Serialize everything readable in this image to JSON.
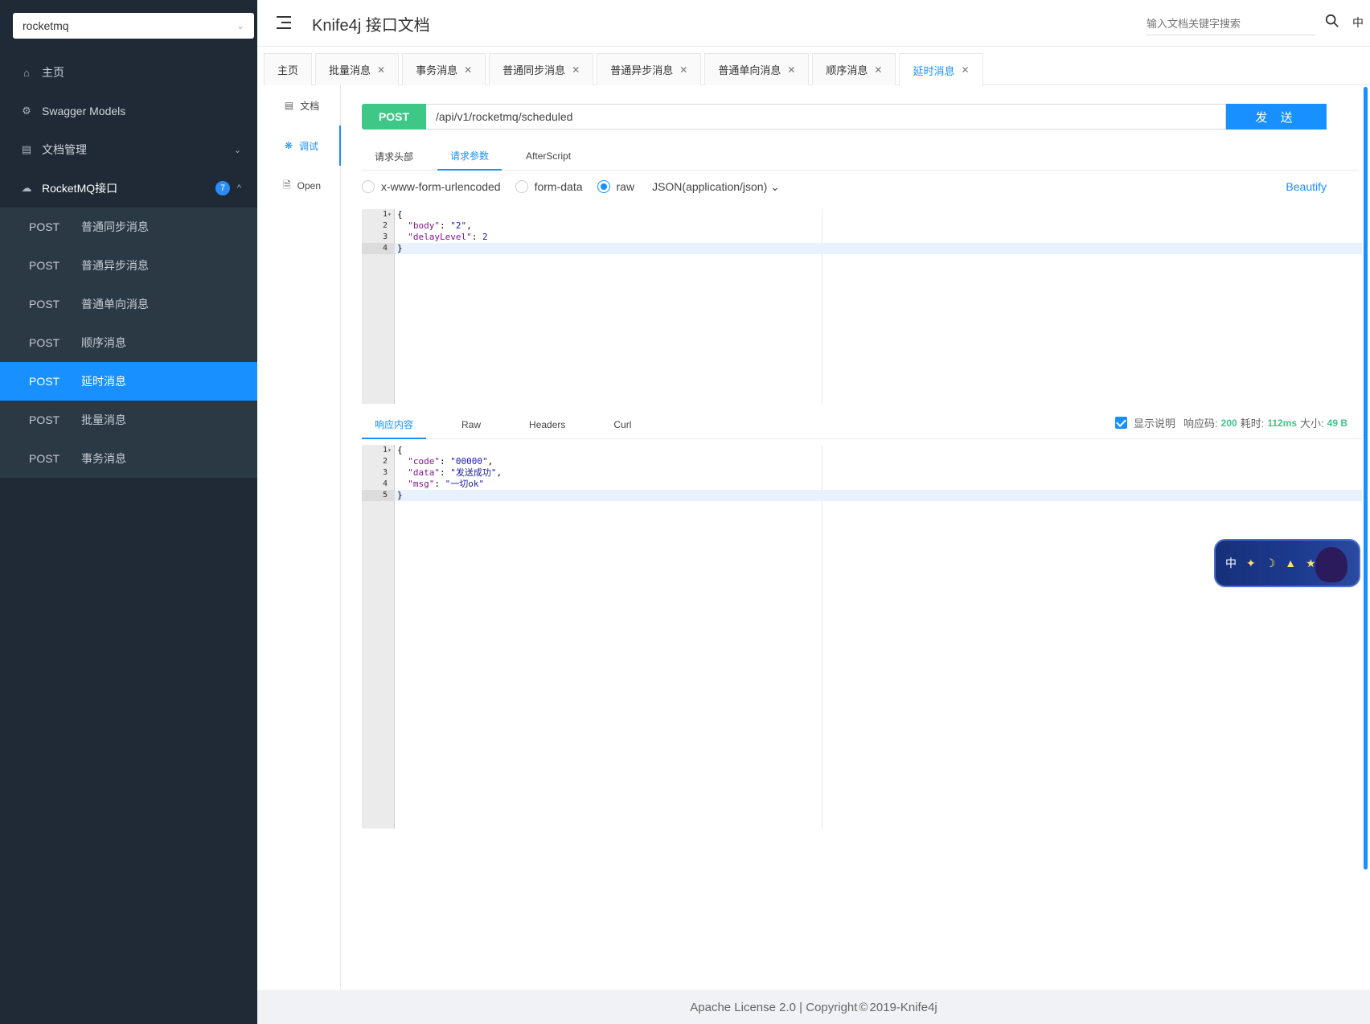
{
  "sidebar": {
    "group_select": "rocketmq",
    "items": [
      {
        "label": "主页",
        "icon": "home-icon"
      },
      {
        "label": "Swagger Models",
        "icon": "gear-icon"
      },
      {
        "label": "文档管理",
        "icon": "document-manage-icon"
      },
      {
        "label": "RocketMQ接口",
        "icon": "cloud-icon",
        "badge": "7"
      }
    ],
    "api_items": [
      {
        "method": "POST",
        "label": "普通同步消息"
      },
      {
        "method": "POST",
        "label": "普通异步消息"
      },
      {
        "method": "POST",
        "label": "普通单向消息"
      },
      {
        "method": "POST",
        "label": "顺序消息"
      },
      {
        "method": "POST",
        "label": "延时消息",
        "active": true
      },
      {
        "method": "POST",
        "label": "批量消息"
      },
      {
        "method": "POST",
        "label": "事务消息"
      }
    ]
  },
  "header": {
    "title": "Knife4j 接口文档",
    "search_placeholder": "输入文档关键字搜索",
    "lang": "中"
  },
  "tabs": [
    {
      "label": "主页",
      "closable": false
    },
    {
      "label": "批量消息",
      "closable": true
    },
    {
      "label": "事务消息",
      "closable": true
    },
    {
      "label": "普通同步消息",
      "closable": true
    },
    {
      "label": "普通异步消息",
      "closable": true
    },
    {
      "label": "普通单向消息",
      "closable": true
    },
    {
      "label": "顺序消息",
      "closable": true
    },
    {
      "label": "延时消息",
      "closable": true,
      "active": true
    }
  ],
  "doc_nav": [
    {
      "label": "文档",
      "icon": "document-icon"
    },
    {
      "label": "调试",
      "icon": "bug-icon",
      "active": true
    },
    {
      "label": "Open",
      "icon": "file-icon"
    }
  ],
  "request": {
    "method": "POST",
    "url": "/api/v1/rocketmq/scheduled",
    "send_label": "发 送",
    "tabs": [
      "请求头部",
      "请求参数",
      "AfterScript"
    ],
    "active_tab": "请求参数",
    "body_types": [
      "x-www-form-urlencoded",
      "form-data",
      "raw"
    ],
    "selected_body_type": "raw",
    "content_type": "JSON(application/json)",
    "beautify_label": "Beautify",
    "body_lines": [
      "{",
      "  \"body\": \"2\",",
      "  \"delayLevel\": 2",
      "}"
    ]
  },
  "response": {
    "tabs": [
      "响应内容",
      "Raw",
      "Headers",
      "Curl"
    ],
    "active_tab": "响应内容",
    "show_desc_label": "显示说明",
    "status_label": "响应码:",
    "status": "200",
    "time_label": "耗时:",
    "time": "112ms",
    "size_label": "大小:",
    "size": "49 B",
    "body_lines": [
      "{",
      "  \"code\": \"00000\",",
      "  \"data\": \"发送成功\",",
      "  \"msg\": \"一切ok\"",
      "}"
    ]
  },
  "widget": {
    "lang": "中"
  },
  "footer": {
    "text_left": "Apache License 2.0 | Copyright",
    "symbol": "©",
    "text_right": "2019-Knife4j"
  }
}
